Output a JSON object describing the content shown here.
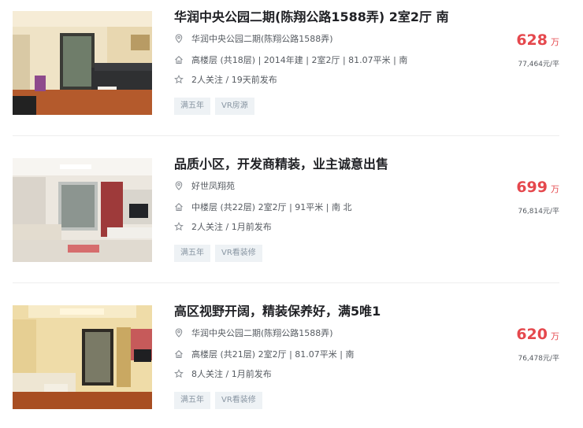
{
  "listings": [
    {
      "title": "华润中央公园二期(陈翔公路1588弄) 2室2厅 南",
      "community": "华润中央公园二期(陈翔公路1588弄)",
      "house_info": "高楼层 (共18层) | 2014年建 | 2室2厅 | 81.07平米 | 南",
      "follow_info": "2人关注 / 19天前发布",
      "tags": [
        "满五年",
        "VR房源"
      ],
      "total_price": "628",
      "price_unit": "万",
      "unit_price": "77,464元/平"
    },
    {
      "title": "品质小区，开发商精装，业主诚意出售",
      "community": "好世凤翔苑",
      "house_info": "中楼层 (共22层) 2室2厅 | 91平米 | 南 北",
      "follow_info": "2人关注 / 1月前发布",
      "tags": [
        "满五年",
        "VR看装修"
      ],
      "total_price": "699",
      "price_unit": "万",
      "unit_price": "76,814元/平"
    },
    {
      "title": "高区视野开阔，精装保养好，满5唯1",
      "community": "华润中央公园二期(陈翔公路1588弄)",
      "house_info": "高楼层 (共21层) 2室2厅 | 81.07平米 | 南",
      "follow_info": "8人关注 / 1月前发布",
      "tags": [
        "满五年",
        "VR看装修"
      ],
      "total_price": "620",
      "price_unit": "万",
      "unit_price": "76,478元/平"
    }
  ],
  "icons": {
    "location": "map-pin-icon",
    "house": "house-icon",
    "follow": "star-icon"
  },
  "colors": {
    "price": "#e5484d",
    "title": "#1f2024",
    "tag_bg": "#eef2f5",
    "tag_text": "#8996a3"
  }
}
